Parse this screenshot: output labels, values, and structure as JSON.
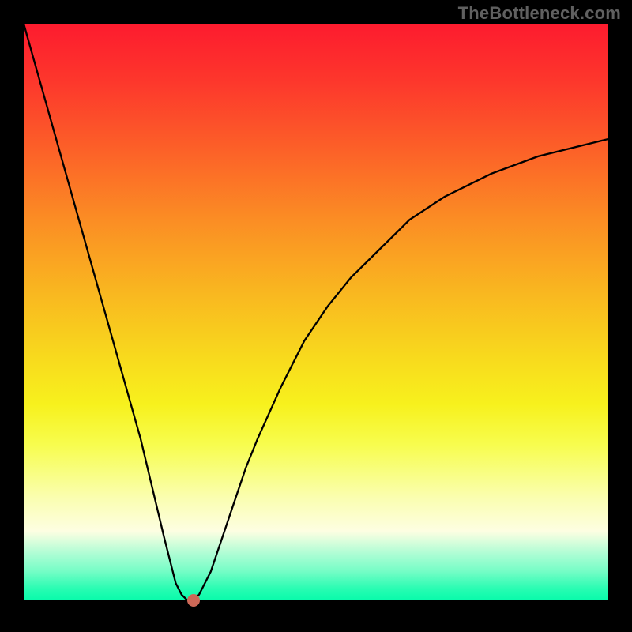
{
  "watermark": "TheBottleneck.com",
  "chart_data": {
    "type": "line",
    "title": "",
    "xlabel": "",
    "ylabel": "",
    "xlim": [
      0,
      100
    ],
    "ylim": [
      0,
      100
    ],
    "grid": false,
    "legend": false,
    "series": [
      {
        "name": "bottleneck-curve",
        "x": [
          0,
          5,
          10,
          15,
          20,
          24,
          26,
          27,
          28,
          29,
          30,
          32,
          34,
          36,
          38,
          40,
          44,
          48,
          52,
          56,
          60,
          66,
          72,
          80,
          88,
          96,
          100
        ],
        "y": [
          100,
          82,
          64,
          46,
          28,
          11,
          3,
          1,
          0,
          0,
          1,
          5,
          11,
          17,
          23,
          28,
          37,
          45,
          51,
          56,
          60,
          66,
          70,
          74,
          77,
          79,
          80
        ]
      }
    ],
    "markers": [
      {
        "name": "vertex-dot",
        "x": 29,
        "y": 0,
        "color": "#cd6857"
      }
    ],
    "background_gradient": {
      "top": "#fd1b2e",
      "mid": "#f8da1d",
      "bottom": "#08fbab"
    }
  }
}
